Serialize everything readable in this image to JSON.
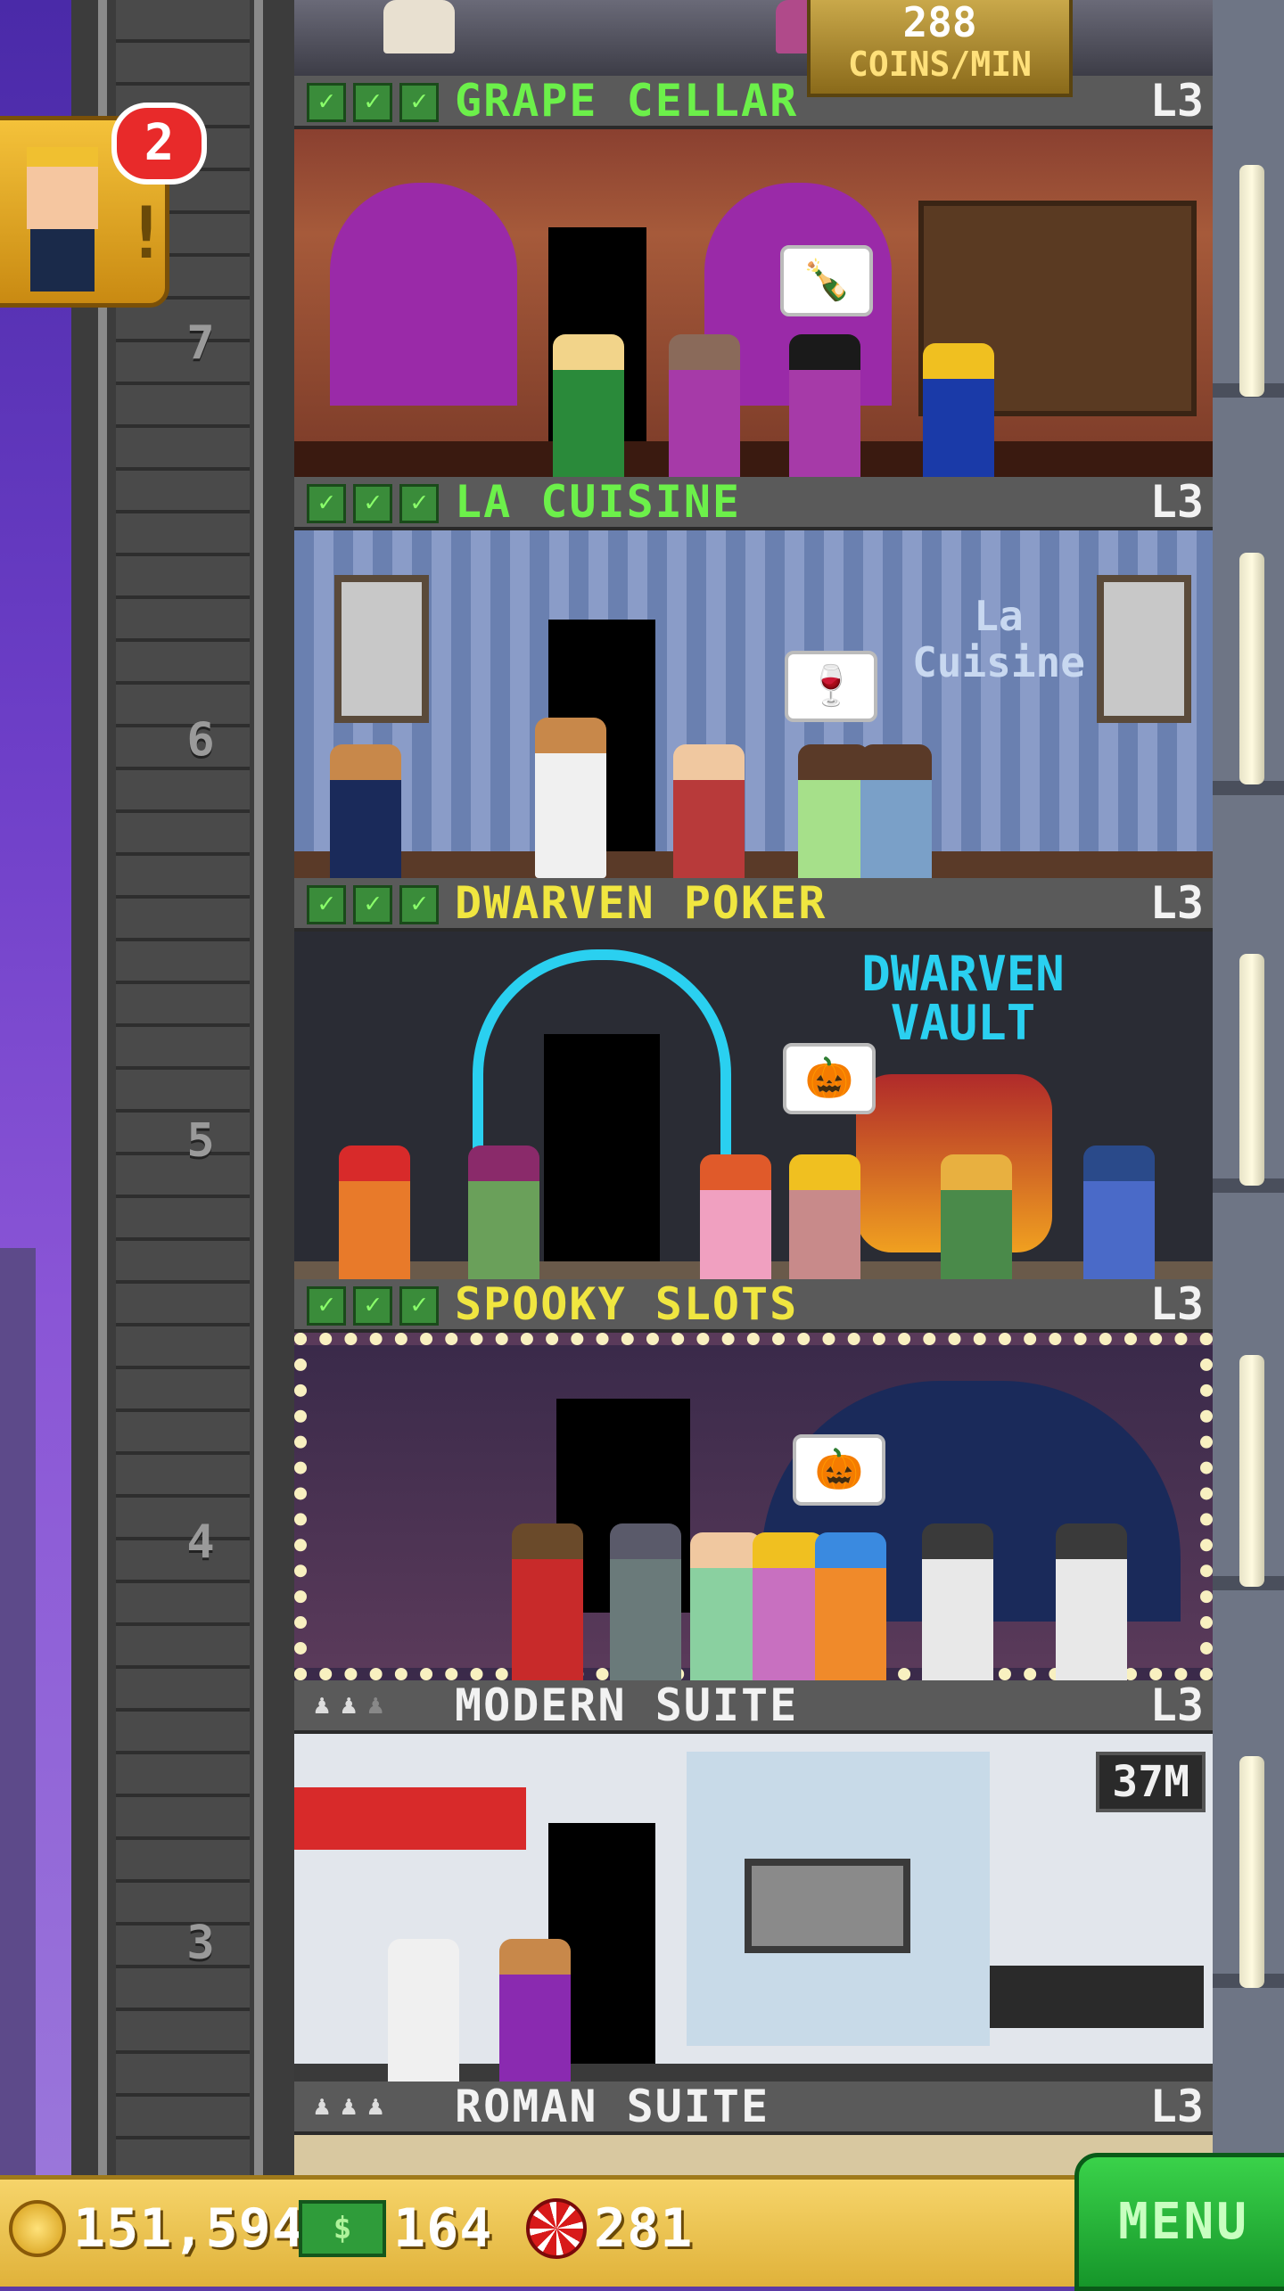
{
  "vip": {
    "notification_count": "2"
  },
  "income": {
    "amount": "288",
    "unit": "COINS/MIN"
  },
  "floors": [
    {
      "number": "7",
      "name": "GRAPE CELLAR",
      "level": "L3",
      "color": "#6cf04a",
      "status": "stocked"
    },
    {
      "number": "6",
      "name": "LA CUISINE",
      "level": "L3",
      "color": "#6cf04a",
      "status": "stocked",
      "sign": "La Cuisine"
    },
    {
      "number": "5",
      "name": "DWARVEN POKER",
      "level": "L3",
      "color": "#f0e640",
      "status": "stocked",
      "sign": "DWARVEN VAULT"
    },
    {
      "number": "4",
      "name": "SPOOKY SLOTS",
      "level": "L3",
      "color": "#f0e640",
      "status": "stocked"
    },
    {
      "number": "3",
      "name": "MODERN SUITE",
      "level": "L3",
      "color": "#f2f2f2",
      "status": "residential",
      "rent": "37M"
    },
    {
      "name": "ROMAN SUITE",
      "level": "L3",
      "color": "#f2f2f2",
      "status": "residential"
    }
  ],
  "resources": {
    "coins": "151,594",
    "bux": "164",
    "chips": "281"
  },
  "menu_label": "MENU"
}
